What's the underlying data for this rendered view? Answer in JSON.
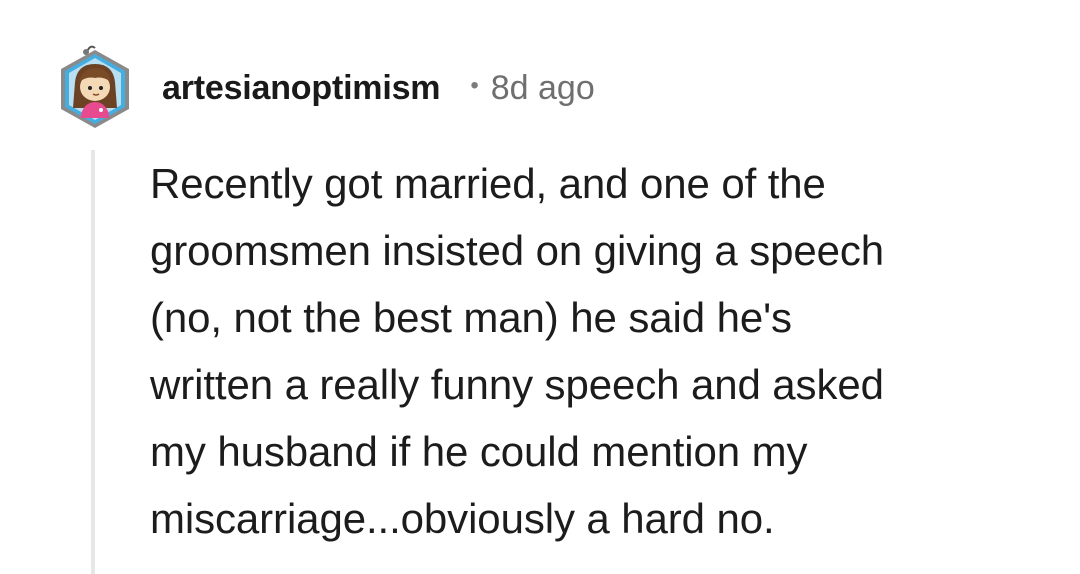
{
  "comment": {
    "author": "artesianoptimism",
    "separator": "•",
    "age": "8d ago",
    "avatar_icon": "user-avatar-snoo-girl-icon",
    "body_lines": [
      "Recently got married, and one of the",
      "groomsmen insisted on giving a speech",
      "(no, not the best man) he said he's",
      "written a really funny speech and asked",
      "my husband if he could mention my",
      "miscarriage...obviously a hard no."
    ]
  },
  "colors": {
    "text": "#1c1c1c",
    "muted": "#6f6f6f",
    "thread_line": "#e6e6e6",
    "avatar_border": "#3a9fd0",
    "avatar_outline": "#7a7a7a"
  }
}
